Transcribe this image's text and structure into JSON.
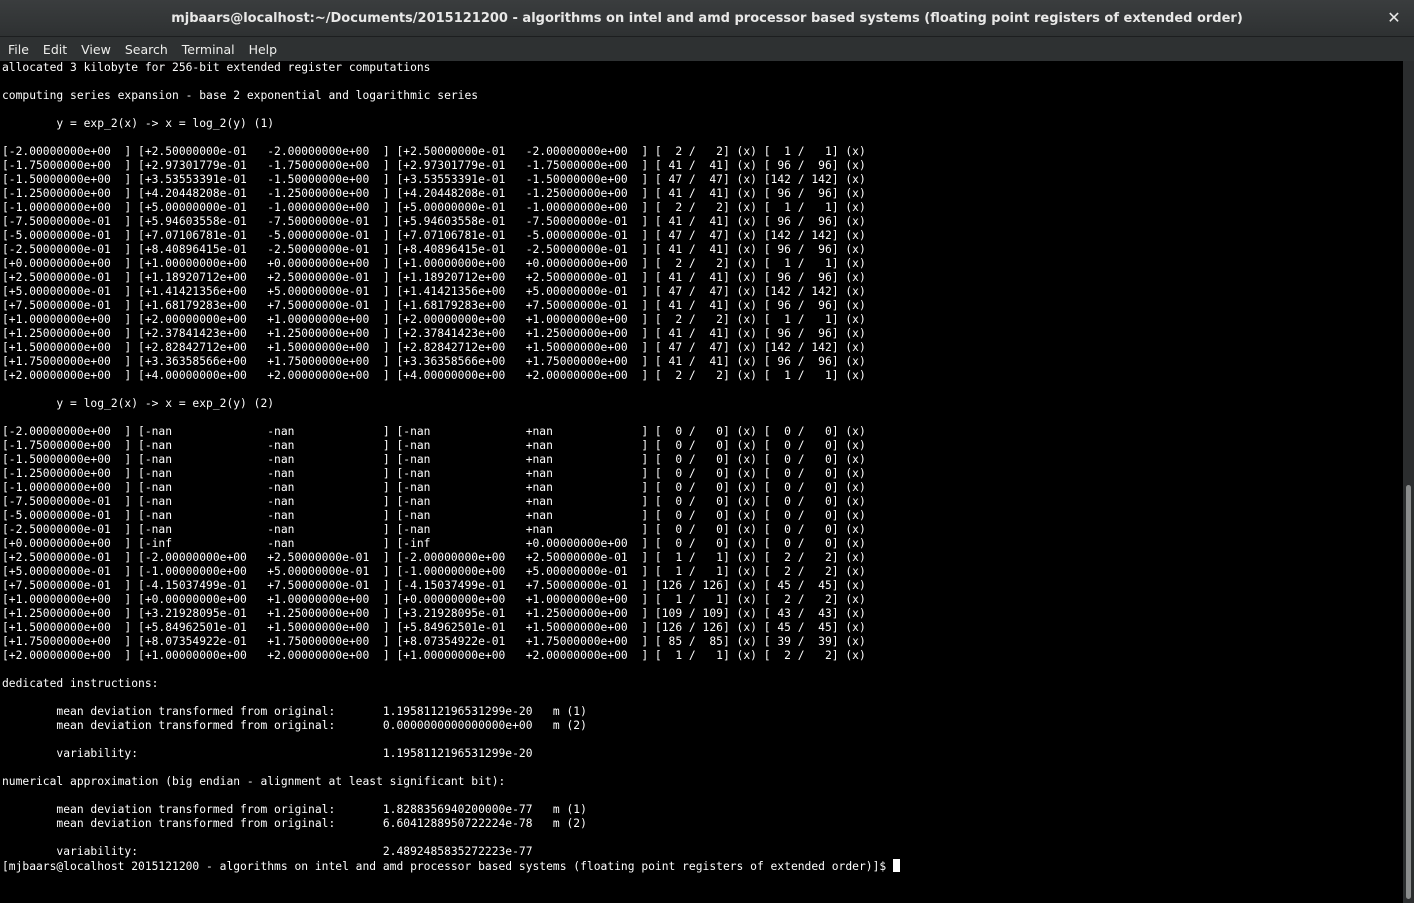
{
  "window": {
    "title": "mjbaars@localhost:~/Documents/2015121200 - algorithms on intel and amd processor based systems (floating point registers of extended order)",
    "close_glyph": "✕"
  },
  "menu": {
    "items": [
      "File",
      "Edit",
      "View",
      "Search",
      "Terminal",
      "Help"
    ]
  },
  "terminal": {
    "output": "allocated 3 kilobyte for 256-bit extended register computations\n\ncomputing series expansion - base 2 exponential and logarithmic series\n\n        y = exp_2(x) -> x = log_2(y) (1)\n\n[-2.00000000e+00  ] [+2.50000000e-01   -2.00000000e+00  ] [+2.50000000e-01   -2.00000000e+00  ] [  2 /   2] (x) [  1 /   1] (x)\n[-1.75000000e+00  ] [+2.97301779e-01   -1.75000000e+00  ] [+2.97301779e-01   -1.75000000e+00  ] [ 41 /  41] (x) [ 96 /  96] (x)\n[-1.50000000e+00  ] [+3.53553391e-01   -1.50000000e+00  ] [+3.53553391e-01   -1.50000000e+00  ] [ 47 /  47] (x) [142 / 142] (x)\n[-1.25000000e+00  ] [+4.20448208e-01   -1.25000000e+00  ] [+4.20448208e-01   -1.25000000e+00  ] [ 41 /  41] (x) [ 96 /  96] (x)\n[-1.00000000e+00  ] [+5.00000000e-01   -1.00000000e+00  ] [+5.00000000e-01   -1.00000000e+00  ] [  2 /   2] (x) [  1 /   1] (x)\n[-7.50000000e-01  ] [+5.94603558e-01   -7.50000000e-01  ] [+5.94603558e-01   -7.50000000e-01  ] [ 41 /  41] (x) [ 96 /  96] (x)\n[-5.00000000e-01  ] [+7.07106781e-01   -5.00000000e-01  ] [+7.07106781e-01   -5.00000000e-01  ] [ 47 /  47] (x) [142 / 142] (x)\n[-2.50000000e-01  ] [+8.40896415e-01   -2.50000000e-01  ] [+8.40896415e-01   -2.50000000e-01  ] [ 41 /  41] (x) [ 96 /  96] (x)\n[+0.00000000e+00  ] [+1.00000000e+00   +0.00000000e+00  ] [+1.00000000e+00   +0.00000000e+00  ] [  2 /   2] (x) [  1 /   1] (x)\n[+2.50000000e-01  ] [+1.18920712e+00   +2.50000000e-01  ] [+1.18920712e+00   +2.50000000e-01  ] [ 41 /  41] (x) [ 96 /  96] (x)\n[+5.00000000e-01  ] [+1.41421356e+00   +5.00000000e-01  ] [+1.41421356e+00   +5.00000000e-01  ] [ 47 /  47] (x) [142 / 142] (x)\n[+7.50000000e-01  ] [+1.68179283e+00   +7.50000000e-01  ] [+1.68179283e+00   +7.50000000e-01  ] [ 41 /  41] (x) [ 96 /  96] (x)\n[+1.00000000e+00  ] [+2.00000000e+00   +1.00000000e+00  ] [+2.00000000e+00   +1.00000000e+00  ] [  2 /   2] (x) [  1 /   1] (x)\n[+1.25000000e+00  ] [+2.37841423e+00   +1.25000000e+00  ] [+2.37841423e+00   +1.25000000e+00  ] [ 41 /  41] (x) [ 96 /  96] (x)\n[+1.50000000e+00  ] [+2.82842712e+00   +1.50000000e+00  ] [+2.82842712e+00   +1.50000000e+00  ] [ 47 /  47] (x) [142 / 142] (x)\n[+1.75000000e+00  ] [+3.36358566e+00   +1.75000000e+00  ] [+3.36358566e+00   +1.75000000e+00  ] [ 41 /  41] (x) [ 96 /  96] (x)\n[+2.00000000e+00  ] [+4.00000000e+00   +2.00000000e+00  ] [+4.00000000e+00   +2.00000000e+00  ] [  2 /   2] (x) [  1 /   1] (x)\n\n        y = log_2(x) -> x = exp_2(y) (2)\n\n[-2.00000000e+00  ] [-nan              -nan             ] [-nan              +nan             ] [  0 /   0] (x) [  0 /   0] (x)\n[-1.75000000e+00  ] [-nan              -nan             ] [-nan              +nan             ] [  0 /   0] (x) [  0 /   0] (x)\n[-1.50000000e+00  ] [-nan              -nan             ] [-nan              +nan             ] [  0 /   0] (x) [  0 /   0] (x)\n[-1.25000000e+00  ] [-nan              -nan             ] [-nan              +nan             ] [  0 /   0] (x) [  0 /   0] (x)\n[-1.00000000e+00  ] [-nan              -nan             ] [-nan              +nan             ] [  0 /   0] (x) [  0 /   0] (x)\n[-7.50000000e-01  ] [-nan              -nan             ] [-nan              +nan             ] [  0 /   0] (x) [  0 /   0] (x)\n[-5.00000000e-01  ] [-nan              -nan             ] [-nan              +nan             ] [  0 /   0] (x) [  0 /   0] (x)\n[-2.50000000e-01  ] [-nan              -nan             ] [-nan              +nan             ] [  0 /   0] (x) [  0 /   0] (x)\n[+0.00000000e+00  ] [-inf              -nan             ] [-inf              +0.00000000e+00  ] [  0 /   0] (x) [  0 /   0] (x)\n[+2.50000000e-01  ] [-2.00000000e+00   +2.50000000e-01  ] [-2.00000000e+00   +2.50000000e-01  ] [  1 /   1] (x) [  2 /   2] (x)\n[+5.00000000e-01  ] [-1.00000000e+00   +5.00000000e-01  ] [-1.00000000e+00   +5.00000000e-01  ] [  1 /   1] (x) [  2 /   2] (x)\n[+7.50000000e-01  ] [-4.15037499e-01   +7.50000000e-01  ] [-4.15037499e-01   +7.50000000e-01  ] [126 / 126] (x) [ 45 /  45] (x)\n[+1.00000000e+00  ] [+0.00000000e+00   +1.00000000e+00  ] [+0.00000000e+00   +1.00000000e+00  ] [  1 /   1] (x) [  2 /   2] (x)\n[+1.25000000e+00  ] [+3.21928095e-01   +1.25000000e+00  ] [+3.21928095e-01   +1.25000000e+00  ] [109 / 109] (x) [ 43 /  43] (x)\n[+1.50000000e+00  ] [+5.84962501e-01   +1.50000000e+00  ] [+5.84962501e-01   +1.50000000e+00  ] [126 / 126] (x) [ 45 /  45] (x)\n[+1.75000000e+00  ] [+8.07354922e-01   +1.75000000e+00  ] [+8.07354922e-01   +1.75000000e+00  ] [ 85 /  85] (x) [ 39 /  39] (x)\n[+2.00000000e+00  ] [+1.00000000e+00   +2.00000000e+00  ] [+1.00000000e+00   +2.00000000e+00  ] [  1 /   1] (x) [  2 /   2] (x)\n\ndedicated instructions:\n\n        mean deviation transformed from original:       1.1958112196531299e-20   m (1)\n        mean deviation transformed from original:       0.0000000000000000e+00   m (2)\n\n        variability:                                    1.1958112196531299e-20\n\nnumerical approximation (big endian - alignment at least significant bit):\n\n        mean deviation transformed from original:       1.8288356940200000e-77   m (1)\n        mean deviation transformed from original:       6.6041288950722224e-78   m (2)\n\n        variability:                                    2.4892485835272223e-77\n",
    "prompt": "[mjbaars@localhost 2015121200 - algorithms on intel and amd processor based systems (floating point registers of extended order)]$ "
  }
}
